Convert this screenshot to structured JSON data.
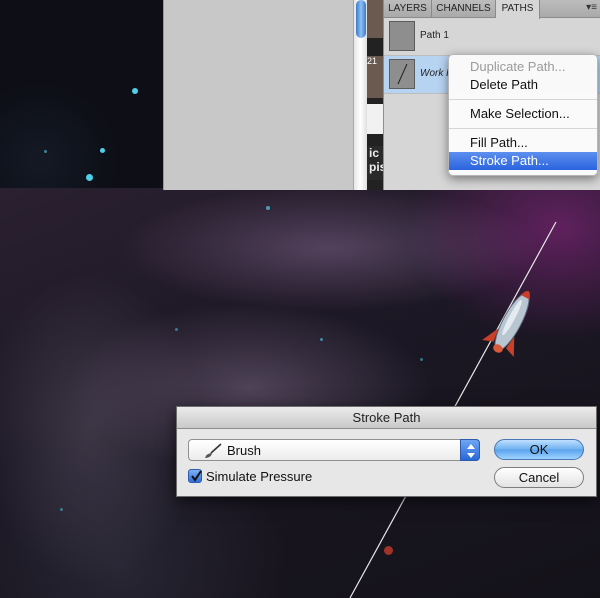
{
  "panel": {
    "tabs": [
      "LAYERS",
      "CHANNELS",
      "PATHS"
    ],
    "active_tab": "PATHS",
    "thumb_text": "ic\npise",
    "thumb_number": "21",
    "paths": [
      {
        "label": "Path 1"
      },
      {
        "label": "Work P"
      }
    ]
  },
  "context_menu": {
    "items": [
      {
        "label": "Duplicate Path...",
        "state": "disabled"
      },
      {
        "label": "Delete Path",
        "state": "normal"
      },
      {
        "label": "Make Selection...",
        "state": "normal"
      },
      {
        "label": "Fill Path...",
        "state": "normal"
      },
      {
        "label": "Stroke Path...",
        "state": "highlighted"
      }
    ]
  },
  "dialog": {
    "title": "Stroke Path",
    "tool_select": {
      "value": "Brush"
    },
    "simulate_pressure": {
      "label": "Simulate Pressure",
      "checked": true
    },
    "ok_label": "OK",
    "cancel_label": "Cancel"
  },
  "colors": {
    "highlight": "#2a63de",
    "selected_row": "#b7d3f2",
    "nebula_magenta": "#962c8c"
  }
}
